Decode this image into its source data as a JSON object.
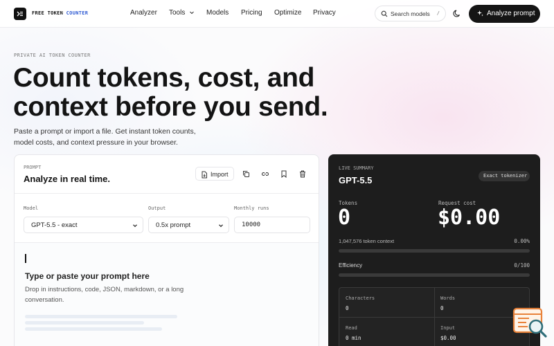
{
  "nav": {
    "brand_a": "FREE TOKEN",
    "brand_b": "COUNTER",
    "links": [
      "Analyzer",
      "Tools",
      "Models",
      "Pricing",
      "Optimize",
      "Privacy"
    ],
    "search_label": "Search models",
    "search_shortcut": "/",
    "cta_label": "Analyze prompt"
  },
  "hero": {
    "eyebrow": "PRIVATE AI TOKEN COUNTER",
    "headline_1": "Count tokens, cost, and",
    "headline_2": "context before you send.",
    "sub_1": "Paste a prompt or import a file. Get instant token counts,",
    "sub_2": "model costs, and context pressure in your browser."
  },
  "prompt_card": {
    "eyebrow": "PROMPT",
    "title": "Analyze in real time.",
    "import_label": "Import",
    "model_label": "Model",
    "model_value": "GPT-5.5 - exact",
    "output_label": "Output",
    "output_value": "0.5x prompt",
    "runs_label": "Monthly runs",
    "runs_value": "10000",
    "editor_title": "Type or paste your prompt here",
    "editor_desc_1": "Drop in instructions, code, JSON, markdown, or a long",
    "editor_desc_2": "conversation."
  },
  "summary": {
    "eyebrow": "LIVE SUMMARY",
    "model": "GPT-5.5",
    "badge": "Exact tokenizer",
    "tokens_label": "Tokens",
    "tokens_value": "0",
    "cost_label": "Request cost",
    "cost_value": "$0.00",
    "context_label": "1,047,576 token context",
    "context_pct": "0.00%",
    "context_fill": 0,
    "efficiency_label": "Efficiency",
    "efficiency_value": "0/100",
    "efficiency_fill": 0,
    "characters_label": "Characters",
    "characters_value": "0",
    "words_label": "Words",
    "words_value": "0",
    "read_label": "Read",
    "read_value": "0 min",
    "input_label": "Input",
    "input_value": "$0.00"
  },
  "colors": {
    "accent_blue": "#2f5bd3",
    "dark_panel": "#1d1d1d",
    "float_icon_orange": "#e8823a",
    "float_icon_teal": "#2f6e79"
  }
}
